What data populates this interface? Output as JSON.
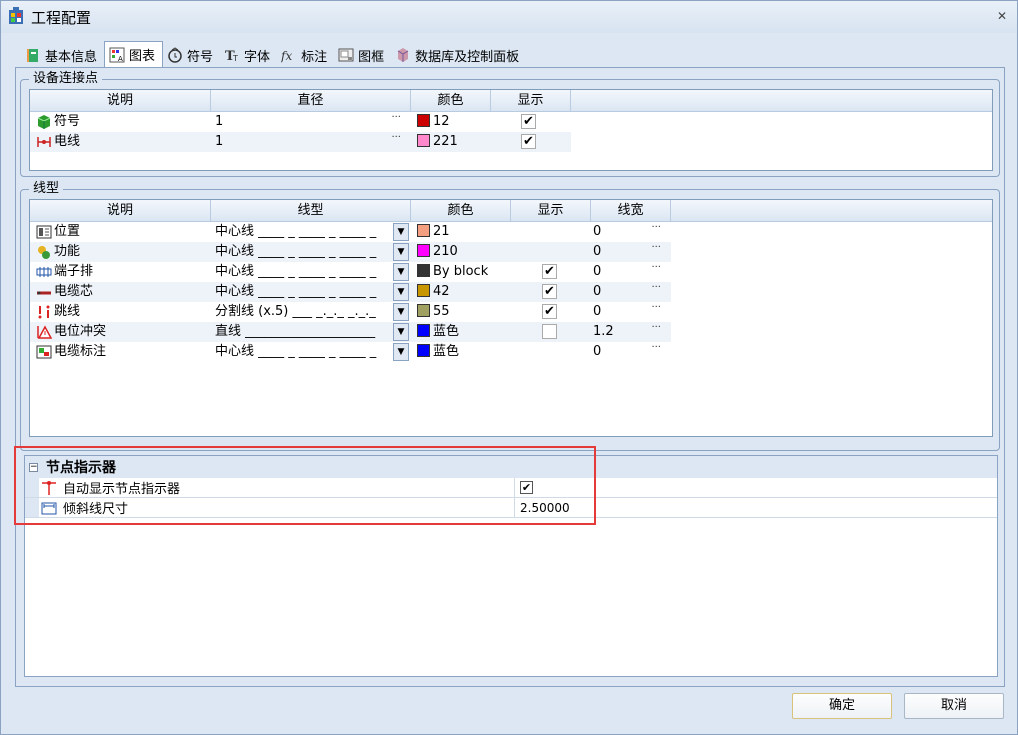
{
  "window": {
    "title": "工程配置"
  },
  "tabs": [
    {
      "label": "基本信息",
      "icon": "book-icon"
    },
    {
      "label": "图表",
      "icon": "chart-icon"
    },
    {
      "label": "符号",
      "icon": "symbol-icon"
    },
    {
      "label": "字体",
      "icon": "font-icon"
    },
    {
      "label": "标注",
      "icon": "fx-icon"
    },
    {
      "label": "图框",
      "icon": "frame-icon"
    },
    {
      "label": "数据库及控制面板",
      "icon": "database-icon"
    }
  ],
  "connection_points": {
    "title": "设备连接点",
    "columns": [
      "说明",
      "直径",
      "颜色",
      "显示"
    ],
    "rows": [
      {
        "label": "符号",
        "icon": "cube-icon",
        "diameter": "1",
        "color_value": "12",
        "swatch": "#cc0000",
        "show": true
      },
      {
        "label": "电线",
        "icon": "wire-icon",
        "diameter": "1",
        "color_value": "221",
        "swatch": "#ff88cc",
        "show": true
      }
    ]
  },
  "line_types": {
    "title": "线型",
    "columns": [
      "说明",
      "线型",
      "颜色",
      "显示",
      "线宽"
    ],
    "rows": [
      {
        "label": "位置",
        "icon": "location-icon",
        "linetype": "中心线 ____ _ ____ _ ____ _",
        "color_value": "21",
        "swatch": "#f4a080",
        "show": null,
        "width": "0"
      },
      {
        "label": "功能",
        "icon": "function-icon",
        "linetype": "中心线 ____ _ ____ _ ____ _",
        "color_value": "210",
        "swatch": "#ff00ff",
        "show": null,
        "width": "0"
      },
      {
        "label": "端子排",
        "icon": "terminal-icon",
        "linetype": "中心线 ____ _ ____ _ ____ _",
        "color_value": "By block",
        "swatch": "#333333",
        "show": true,
        "width": "0"
      },
      {
        "label": "电缆芯",
        "icon": "cable-core-icon",
        "linetype": "中心线 ____ _ ____ _ ____ _",
        "color_value": "42",
        "swatch": "#c89600",
        "show": true,
        "width": "0"
      },
      {
        "label": "跳线",
        "icon": "jumper-icon",
        "linetype": "分割线 (x.5) ___ _._._ _._._",
        "color_value": "55",
        "swatch": "#a0a060",
        "show": true,
        "width": "0"
      },
      {
        "label": "电位冲突",
        "icon": "conflict-icon",
        "linetype": "直线 ____________________",
        "color_value": "蓝色",
        "swatch": "#0000ff",
        "show": false,
        "width": "1.2"
      },
      {
        "label": "电缆标注",
        "icon": "cable-label-icon",
        "linetype": "中心线 ____ _ ____ _ ____ _",
        "color_value": "蓝色",
        "swatch": "#0000ff",
        "show": null,
        "width": "0"
      }
    ]
  },
  "node_indicator": {
    "category": "节点指示器",
    "rows": [
      {
        "name": "自动显示节点指示器",
        "icon": "node-icon",
        "value": "",
        "checked": true
      },
      {
        "name": "倾斜线尺寸",
        "icon": "dimension-icon",
        "value": "2.50000",
        "checked": null
      }
    ]
  },
  "buttons": {
    "ok": "确定",
    "cancel": "取消"
  }
}
